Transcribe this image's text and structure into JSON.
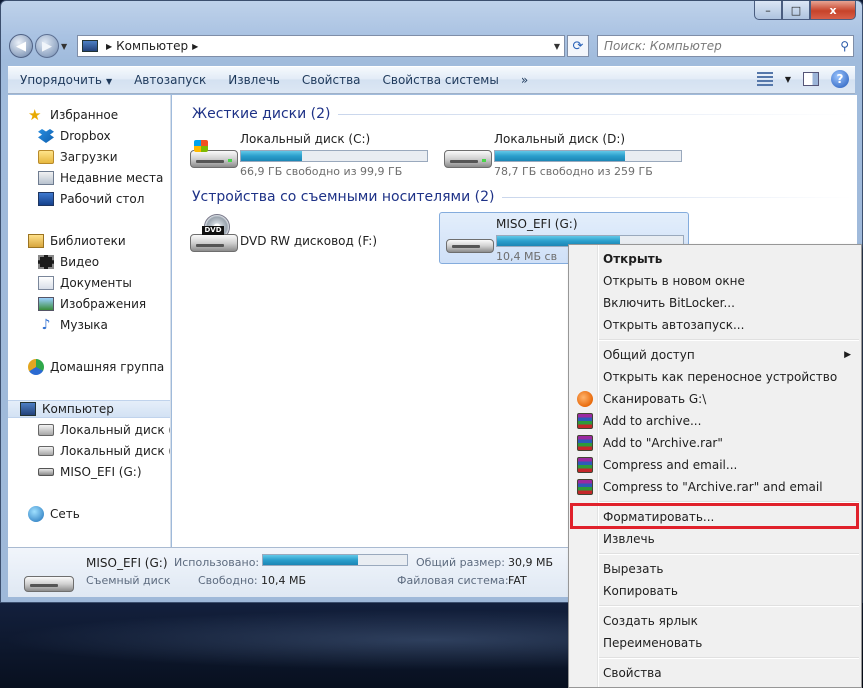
{
  "window": {
    "caption_buttons": {
      "minimize": "–",
      "maximize": "□",
      "close": "x"
    }
  },
  "address": {
    "path": "Компьютер",
    "search_placeholder": "Поиск: Компьютер"
  },
  "commandbar": {
    "organize": "Упорядочить",
    "autoplay": "Автозапуск",
    "eject": "Извлечь",
    "properties": "Свойства",
    "system_properties": "Свойства системы",
    "more": "»"
  },
  "navpane": {
    "favorites": "Избранное",
    "dropbox": "Dropbox",
    "downloads": "Загрузки",
    "recent": "Недавние места",
    "desktop": "Рабочий стол",
    "libraries": "Библиотеки",
    "video": "Видео",
    "documents": "Документы",
    "images": "Изображения",
    "music": "Музыка",
    "homegroup": "Домашняя группа",
    "computer": "Компьютер",
    "local_c": "Локальный диск (C:",
    "local_d": "Локальный диск (D:",
    "miso": "MISO_EFI (G:)",
    "network": "Сеть"
  },
  "content": {
    "hdd_group": "Жесткие диски (2)",
    "removable_group": "Устройства со съемными носителями (2)",
    "drives": [
      {
        "name": "Локальный диск (C:)",
        "free": "66,9 ГБ свободно из 99,9 ГБ",
        "used_fraction": 0.33
      },
      {
        "name": "Локальный диск (D:)",
        "free": "78,7 ГБ свободно из 259 ГБ",
        "used_fraction": 0.7
      },
      {
        "name": "DVD RW дисковод (F:)",
        "dvd_label": "DVD"
      },
      {
        "name": "MISO_EFI (G:)",
        "free": "10,4 МБ св",
        "used_fraction": 0.66
      }
    ]
  },
  "details": {
    "name": "MISO_EFI (G:)",
    "type": "Съемный диск",
    "used_label": "Использовано:",
    "used_fraction": 0.66,
    "free_label": "Свободно:",
    "free_value": "10,4 МБ",
    "total_label": "Общий размер:",
    "total_value": "30,9 МБ",
    "fs_label": "Файловая система:",
    "fs_value": "FAT"
  },
  "context_menu": {
    "items": [
      "Открыть",
      "Открыть в новом окне",
      "Включить BitLocker...",
      "Открыть автозапуск...",
      "Общий доступ",
      "Открыть как переносное устройство",
      "Сканировать G:\\",
      "Add to archive...",
      "Add to \"Archive.rar\"",
      "Compress and email...",
      "Compress to \"Archive.rar\" and email",
      "Форматировать...",
      "Извлечь",
      "Вырезать",
      "Копировать",
      "Создать ярлык",
      "Переименовать",
      "Свойства"
    ],
    "highlight_color": "#e0212b"
  }
}
